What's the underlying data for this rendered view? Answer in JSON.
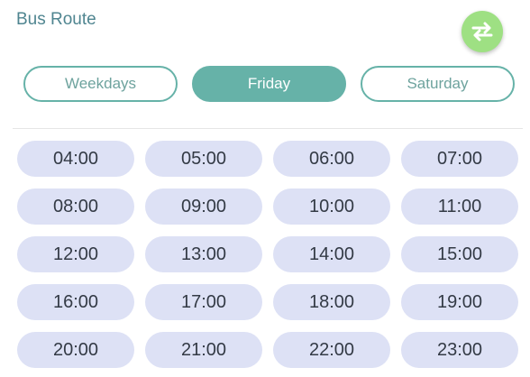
{
  "header": {
    "title": "Bus Route",
    "swap_icon": "swap-arrows-icon",
    "swap_color": "#9ee083"
  },
  "tabs": [
    {
      "label": "Weekdays",
      "active": false
    },
    {
      "label": "Friday",
      "active": true
    },
    {
      "label": "Saturday",
      "active": false
    }
  ],
  "accent_color": "#66b2a8",
  "times": [
    "04:00",
    "05:00",
    "06:00",
    "07:00",
    "08:00",
    "09:00",
    "10:00",
    "11:00",
    "12:00",
    "13:00",
    "14:00",
    "15:00",
    "16:00",
    "17:00",
    "18:00",
    "19:00",
    "20:00",
    "21:00",
    "22:00",
    "23:00"
  ]
}
